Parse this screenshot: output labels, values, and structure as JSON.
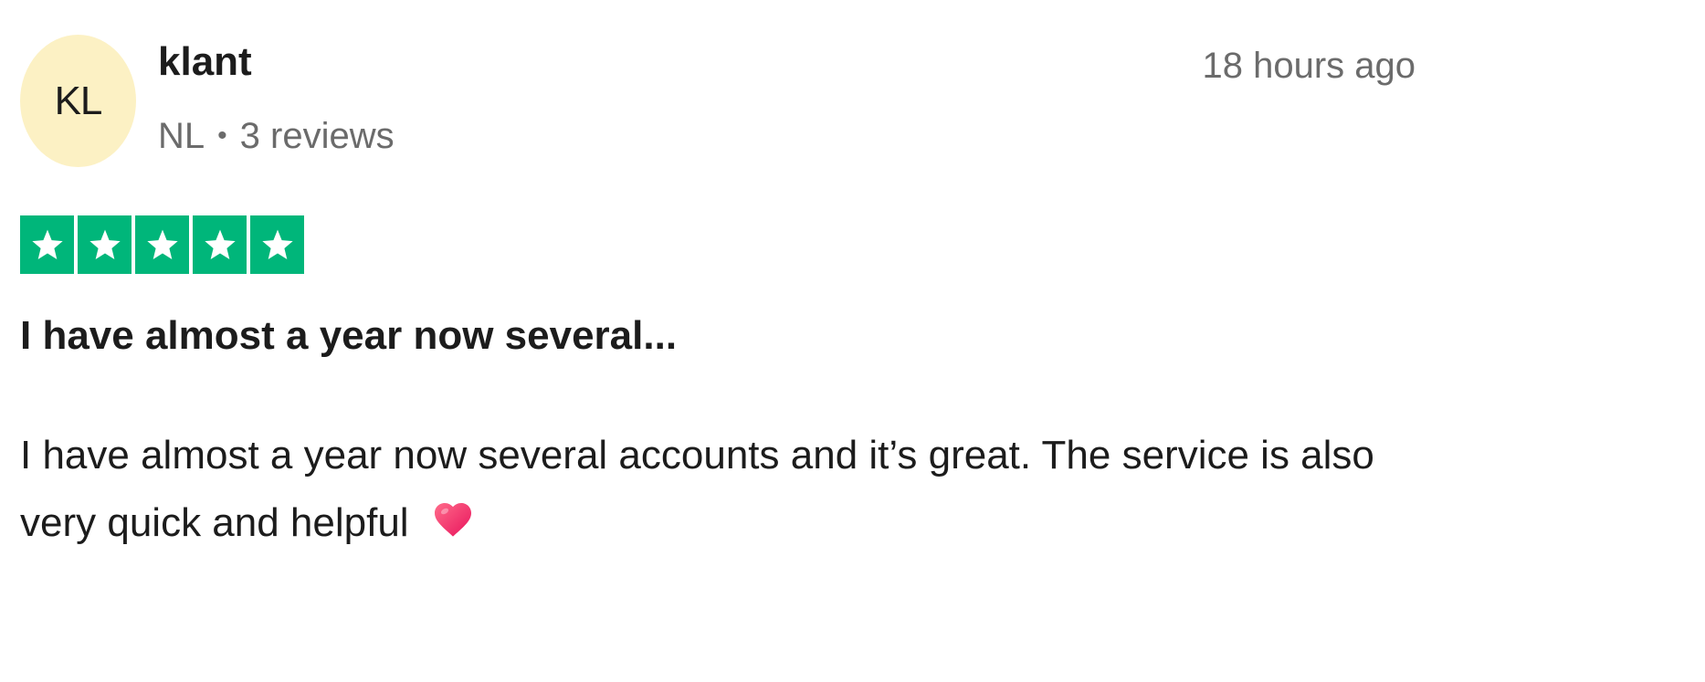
{
  "reviewer": {
    "initials": "KL",
    "name": "klant",
    "country": "NL",
    "separator": "•",
    "review_count": "3 reviews"
  },
  "review": {
    "date": "18 hours ago",
    "rating": 5,
    "rating_color": "#00b67a",
    "title": "I have almost a year now several...",
    "body": "I have almost a year now several accounts and it’s great. The service is also very quick and helpful",
    "emoji_icon": "heart-icon"
  },
  "colors": {
    "avatar_bg": "#fcf1c4",
    "text": "#1c1c1c",
    "muted": "#6b6b6b"
  }
}
